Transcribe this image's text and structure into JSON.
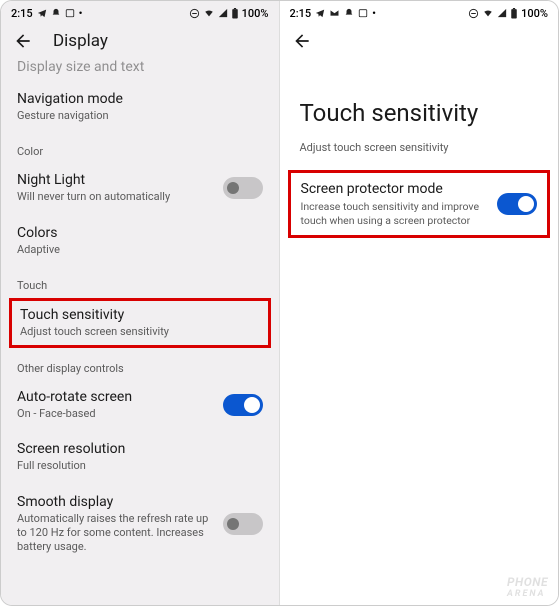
{
  "left": {
    "status": {
      "time": "2:15",
      "battery": "100%"
    },
    "header": {
      "title": "Display"
    },
    "truncated": "Display size and text",
    "nav": {
      "title": "Navigation mode",
      "sub": "Gesture navigation"
    },
    "section_color": "Color",
    "night": {
      "title": "Night Light",
      "sub": "Will never turn on automatically"
    },
    "colors": {
      "title": "Colors",
      "sub": "Adaptive"
    },
    "section_touch": "Touch",
    "touch": {
      "title": "Touch sensitivity",
      "sub": "Adjust touch screen sensitivity"
    },
    "section_other": "Other display controls",
    "autorotate": {
      "title": "Auto-rotate screen",
      "sub": "On - Face-based"
    },
    "resolution": {
      "title": "Screen resolution",
      "sub": "Full resolution"
    },
    "smooth": {
      "title": "Smooth display",
      "sub": "Automatically raises the refresh rate up to 120 Hz for some content. Increases battery usage."
    }
  },
  "right": {
    "status": {
      "time": "2:15",
      "battery": "100%"
    },
    "title": "Touch sensitivity",
    "sub": "Adjust touch screen sensitivity",
    "protector": {
      "title": "Screen protector mode",
      "sub": "Increase touch sensitivity and improve touch when using a screen protector"
    }
  },
  "watermark": {
    "line1": "Phone",
    "line2": "Arena"
  }
}
